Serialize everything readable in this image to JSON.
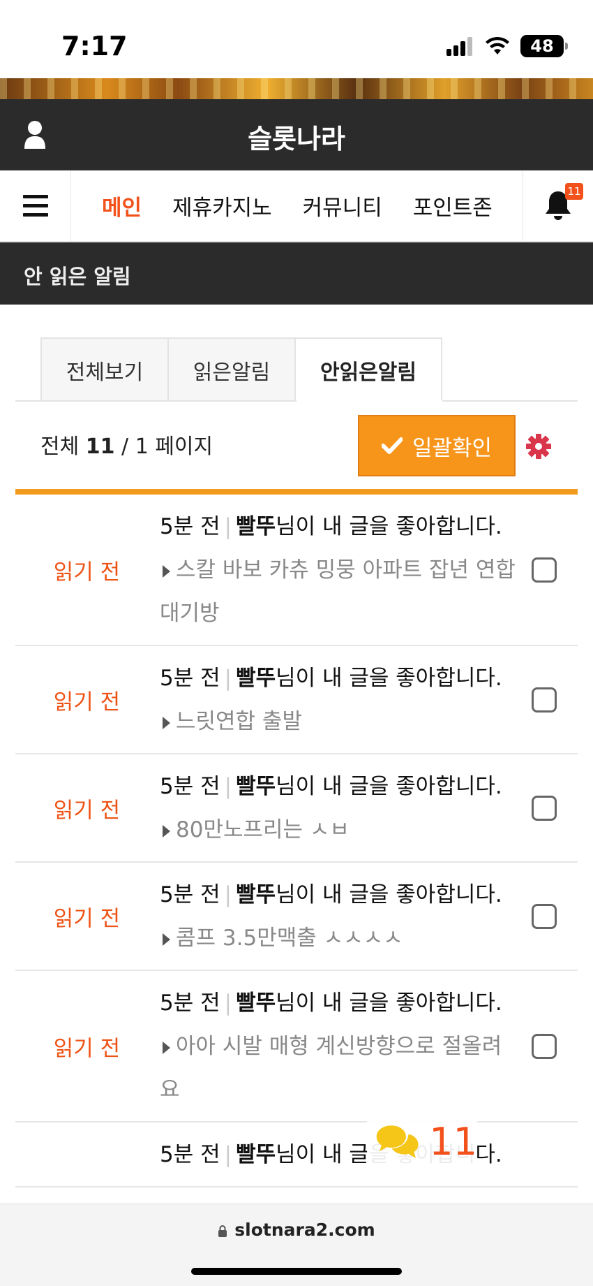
{
  "status_bar": {
    "time": "7:17",
    "battery": "48"
  },
  "header": {
    "site_title": "슬롯나라"
  },
  "nav": {
    "items": [
      {
        "label": "메인",
        "active": true
      },
      {
        "label": "제휴카지노",
        "active": false
      },
      {
        "label": "커뮤니티",
        "active": false
      },
      {
        "label": "포인트존",
        "active": false
      }
    ],
    "bell_badge": "11"
  },
  "page": {
    "heading": "안 읽은 알림"
  },
  "tabs": [
    {
      "label": "전체보기",
      "active": false
    },
    {
      "label": "읽은알림",
      "active": false
    },
    {
      "label": "안읽은알림",
      "active": true
    }
  ],
  "summary": {
    "prefix": "전체",
    "total": "11",
    "page": "/ 1 페이지"
  },
  "confirm_all_label": "일괄확인",
  "notifications": [
    {
      "status": "읽기 전",
      "time": "5분 전",
      "user": "빨뚜",
      "message": "님이 내 글을 좋아합니다.",
      "post": "스칼 바보 카츄 밍뭉 아파트 잡년 연합대기방"
    },
    {
      "status": "읽기 전",
      "time": "5분 전",
      "user": "빨뚜",
      "message": "님이 내 글을 좋아합니다.",
      "post": "느릿연합 출발"
    },
    {
      "status": "읽기 전",
      "time": "5분 전",
      "user": "빨뚜",
      "message": "님이 내 글을 좋아합니다.",
      "post": "80만노프리는 ㅅㅂ"
    },
    {
      "status": "읽기 전",
      "time": "5분 전",
      "user": "빨뚜",
      "message": "님이 내 글을 좋아합니다.",
      "post": "콤프 3.5만맥출 ㅅㅅㅅㅅ"
    },
    {
      "status": "읽기 전",
      "time": "5분 전",
      "user": "빨뚜",
      "message": "님이 내 글을 좋아합니다.",
      "post": "아아 시발 매형 계신방향으로 절올려요"
    },
    {
      "status": "",
      "time": "5분 전",
      "user": "빨뚜",
      "message": "님이 내 글을 좋아합니다.",
      "post": ""
    }
  ],
  "chat": {
    "count": "11"
  },
  "browser": {
    "url": "slotnara2.com"
  },
  "colors": {
    "accent": "#f2511b",
    "button": "#f7951b",
    "dark_header": "#2b2b2b"
  }
}
